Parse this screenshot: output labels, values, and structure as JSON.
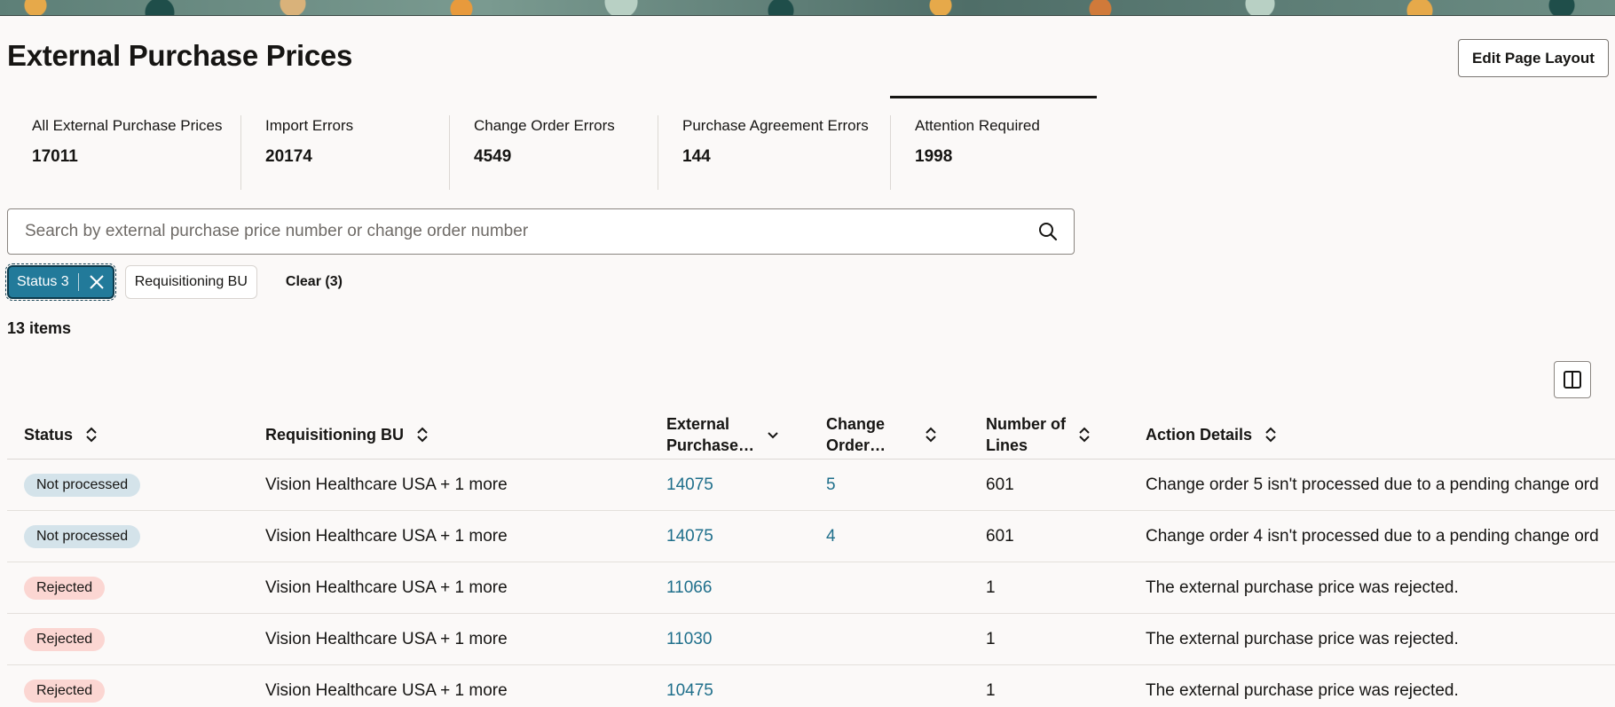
{
  "page": {
    "title": "External Purchase Prices",
    "edit_layout_label": "Edit Page Layout"
  },
  "tabs": [
    {
      "label": "All External Purchase Prices",
      "count": "17011"
    },
    {
      "label": "Import Errors",
      "count": "20174"
    },
    {
      "label": "Change Order Errors",
      "count": "4549"
    },
    {
      "label": "Purchase Agreement Errors",
      "count": "144"
    },
    {
      "label": "Attention Required",
      "count": "1998",
      "active": true
    }
  ],
  "search": {
    "placeholder": "Search by external purchase price number or change order number",
    "value": ""
  },
  "filters": {
    "status_chip": "Status 3",
    "requisitioning_bu_chip": "Requisitioning BU",
    "clear_label": "Clear (3)"
  },
  "results": {
    "count_label": "13 items"
  },
  "table": {
    "headers": {
      "status": "Status",
      "requisitioning_bu": "Requisitioning BU",
      "external_purchase": "External Purchase…",
      "external_purchase_line1": "External",
      "external_purchase_line2": "Purchase…",
      "change_order_line1": "Change",
      "change_order_line2": "Order…",
      "number_of_lines_line1": "Number of",
      "number_of_lines_line2": "Lines",
      "action_details": "Action Details"
    },
    "rows": [
      {
        "status": "Not processed",
        "bu": "Vision Healthcare USA + 1 more",
        "epp": "14075",
        "change_order": "5",
        "lines": "601",
        "action": "Change order 5 isn't processed due to a pending change ord"
      },
      {
        "status": "Not processed",
        "bu": "Vision Healthcare USA + 1 more",
        "epp": "14075",
        "change_order": "4",
        "lines": "601",
        "action": "Change order 4 isn't processed due to a pending change ord"
      },
      {
        "status": "Rejected",
        "bu": "Vision Healthcare USA + 1 more",
        "epp": "11066",
        "change_order": "",
        "lines": "1",
        "action": "The external purchase price was rejected."
      },
      {
        "status": "Rejected",
        "bu": "Vision Healthcare USA + 1 more",
        "epp": "11030",
        "change_order": "",
        "lines": "1",
        "action": "The external purchase price was rejected."
      },
      {
        "status": "Rejected",
        "bu": "Vision Healthcare USA + 1 more",
        "epp": "10475",
        "change_order": "",
        "lines": "1",
        "action": "The external purchase price was rejected."
      }
    ]
  },
  "colors": {
    "accent": "#227a9a",
    "link": "#1f6f8b",
    "not_processed_bg": "#d4e3ea",
    "rejected_bg": "#fbd6d2"
  }
}
